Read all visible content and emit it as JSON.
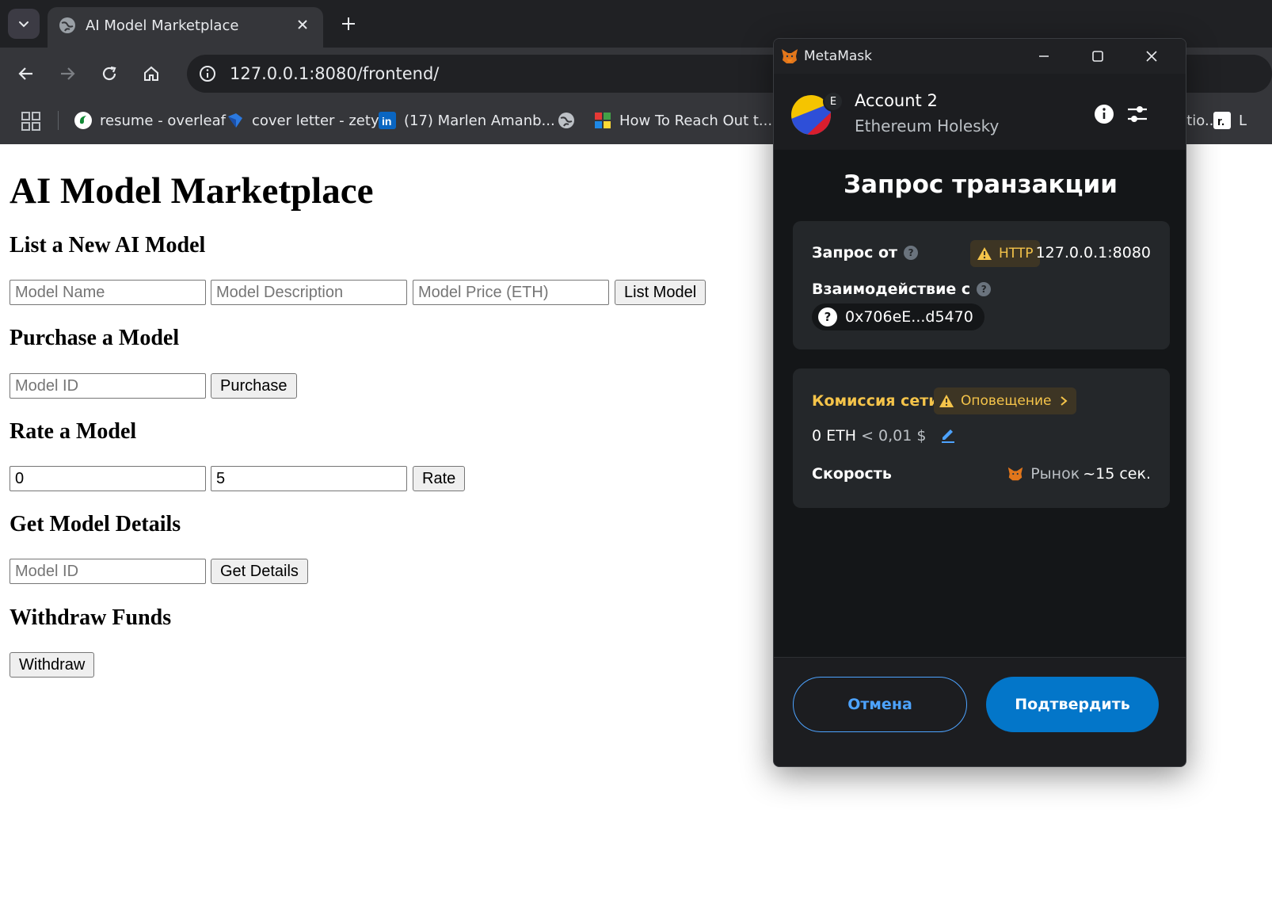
{
  "browser": {
    "tab_title": "AI Model Marketplace",
    "url": "127.0.0.1:8080/frontend/",
    "bookmarks": [
      {
        "label": "resume - overleaf",
        "icon": "overleaf-icon"
      },
      {
        "label": "cover letter - zety",
        "icon": "zety-icon"
      },
      {
        "label": "(17) Marlen Amanb...",
        "icon": "linkedin-icon"
      },
      {
        "label": "",
        "icon": "globe-icon"
      },
      {
        "label": "How To Reach Out t...",
        "icon": "app-grid-icon"
      },
      {
        "label": "...atio...",
        "icon": "page-icon"
      },
      {
        "label": "L",
        "icon": "r-icon"
      }
    ]
  },
  "page": {
    "title": "AI Model Marketplace",
    "list_section": {
      "heading": "List a New AI Model",
      "name_placeholder": "Model Name",
      "description_placeholder": "Model Description",
      "price_placeholder": "Model Price (ETH)",
      "button": "List Model"
    },
    "purchase_section": {
      "heading": "Purchase a Model",
      "id_placeholder": "Model ID",
      "button": "Purchase"
    },
    "rate_section": {
      "heading": "Rate a Model",
      "model_id_value": "0",
      "rating_value": "5",
      "button": "Rate"
    },
    "details_section": {
      "heading": "Get Model Details",
      "id_placeholder": "Model ID",
      "button": "Get Details"
    },
    "withdraw_section": {
      "heading": "Withdraw Funds",
      "button": "Withdraw"
    }
  },
  "metamask": {
    "window_title": "MetaMask",
    "account_name": "Account 2",
    "account_badge": "E",
    "network": "Ethereum Holesky",
    "heading": "Запрос транзакции",
    "request_from_label": "Запрос от",
    "http_badge": "HTTP",
    "origin": "127.0.0.1:8080",
    "interacting_label": "Взаимодействие с",
    "contract_address": "0x706eE...d5470",
    "network_fee_label": "Комиссия сети",
    "alert_label": "Оповещение",
    "fee_eth": "0 ETH",
    "fee_usd": "< 0,01 $",
    "speed_label": "Скорость",
    "speed_value": "Рынок",
    "speed_time": "~15 сек.",
    "cancel_button": "Отмена",
    "confirm_button": "Подтвердить",
    "colors": {
      "accent": "#0376c9",
      "link": "#4da3ff",
      "warning": "#f5c44a",
      "background": "#141618",
      "card": "#24272a"
    }
  }
}
